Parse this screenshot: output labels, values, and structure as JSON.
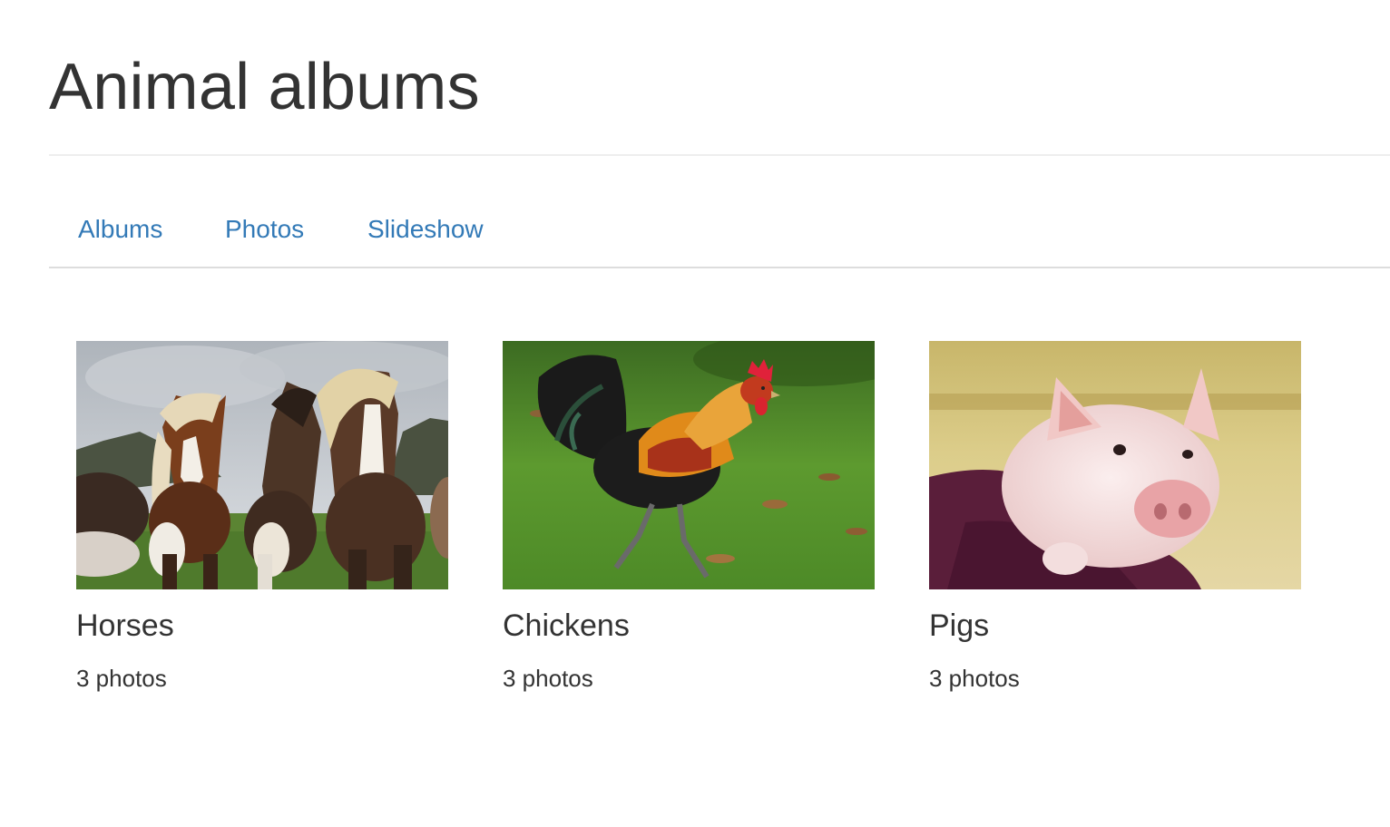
{
  "page": {
    "title": "Animal albums"
  },
  "nav": {
    "items": [
      {
        "label": "Albums"
      },
      {
        "label": "Photos"
      },
      {
        "label": "Slideshow"
      }
    ]
  },
  "albums": [
    {
      "name": "Horses",
      "count": "3 photos",
      "image": "horses-photo"
    },
    {
      "name": "Chickens",
      "count": "3 photos",
      "image": "rooster-photo"
    },
    {
      "name": "Pigs",
      "count": "3 photos",
      "image": "piglet-photo"
    }
  ],
  "colors": {
    "link": "#337ab7",
    "text": "#333333",
    "divider": "#eeeeee",
    "nav_border": "#dddddd"
  }
}
